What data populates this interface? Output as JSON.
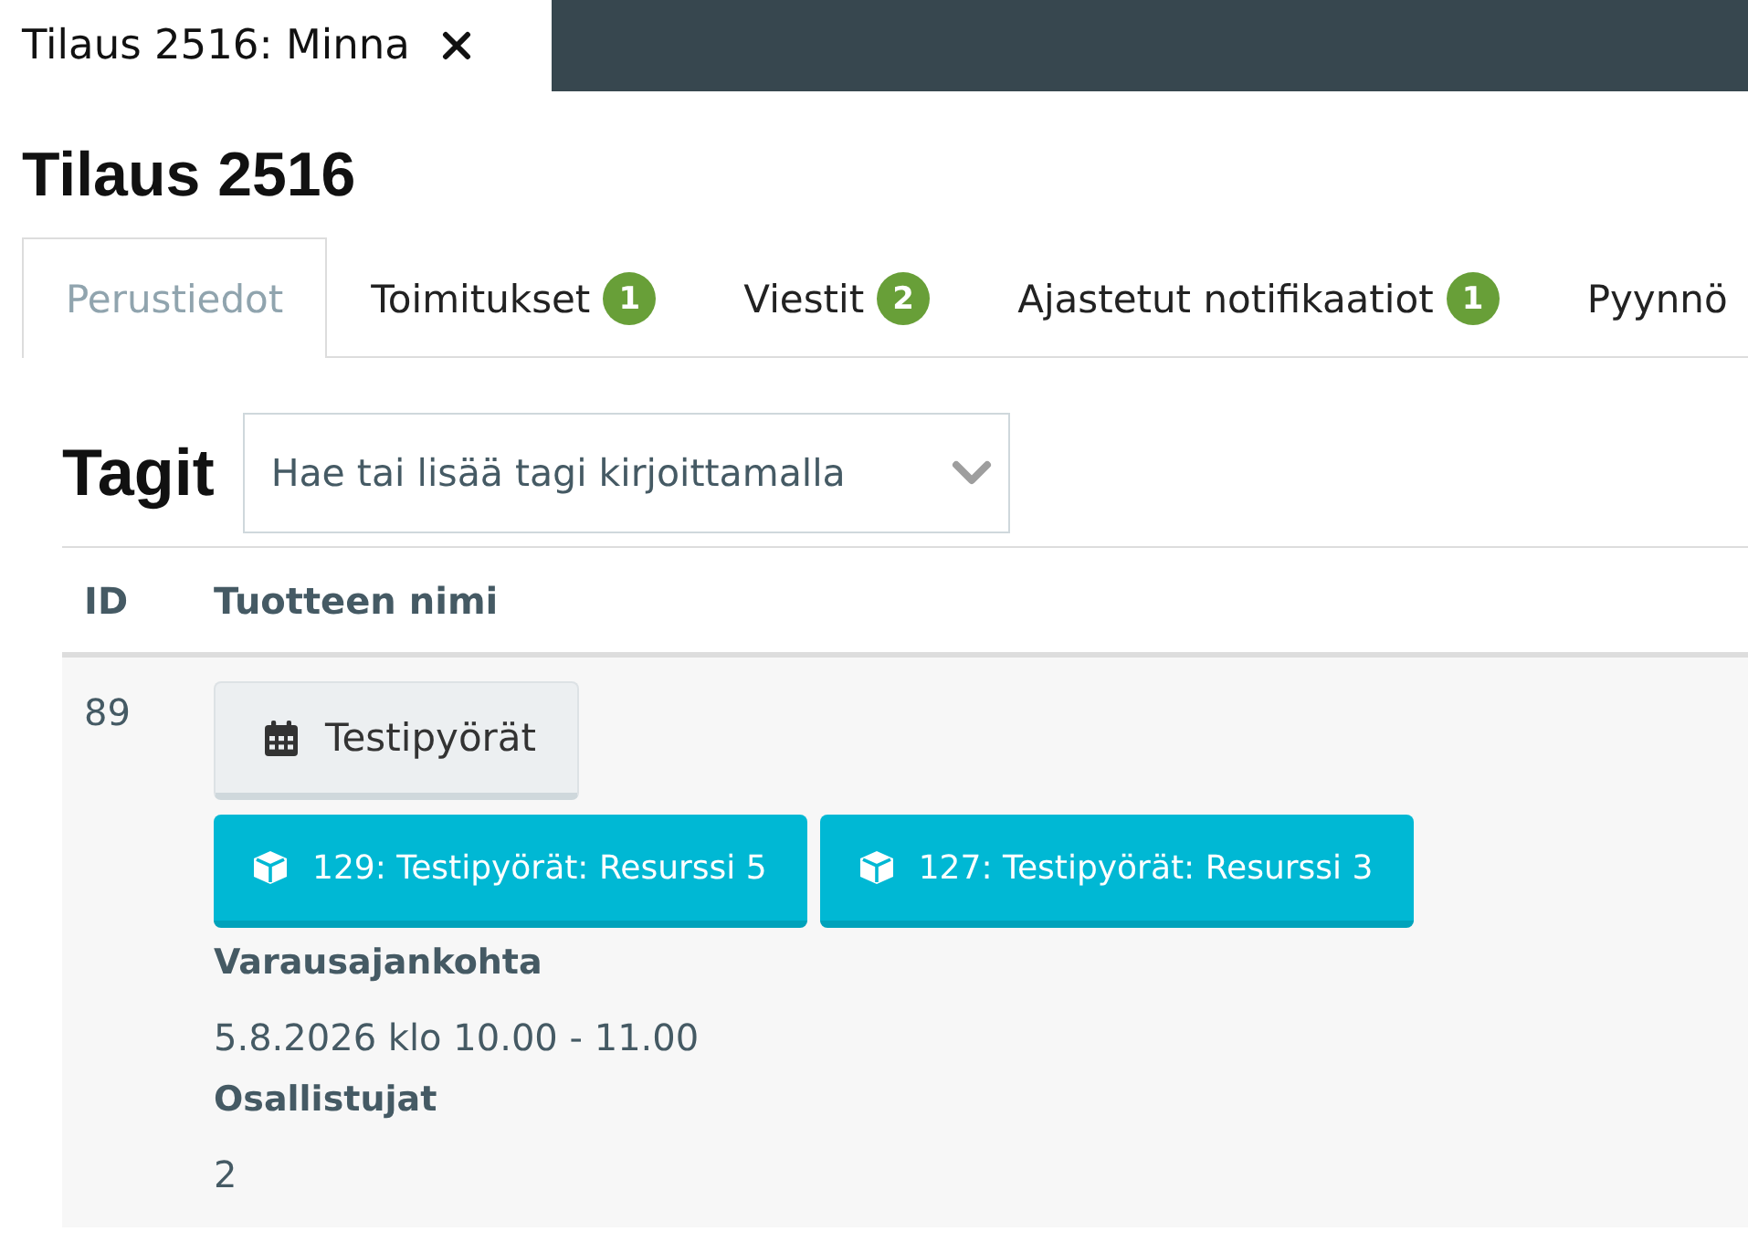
{
  "window_tabs": [
    {
      "title": "Tilaus 2516: Minna",
      "selected": true
    }
  ],
  "title": "Tilaus 2516",
  "tabs": [
    {
      "label": "Perustiedot",
      "selected": true
    },
    {
      "label": "Toimitukset",
      "badge": "1",
      "selected": false
    },
    {
      "label": "Viestit",
      "badge": "2",
      "selected": false
    },
    {
      "label": "Ajastetut notifikaatiot",
      "badge": "1",
      "selected": false
    },
    {
      "label": "Pyynnö",
      "selected": false
    }
  ],
  "tags": {
    "label": "Tagit",
    "placeholder": "Hae tai lisää tagi kirjoittamalla"
  },
  "table": {
    "columns": [
      "ID",
      "Tuotteen nimi"
    ],
    "rows": [
      {
        "id": "89",
        "product": "Testipyörät",
        "resources": [
          "129: Testipyörät: Resurssi 5",
          "127: Testipyörät: Resurssi 3"
        ],
        "details": [
          {
            "label": "Varausajankohta",
            "value": "5.8.2026 klo 10.00 - 11.00"
          },
          {
            "label": "Osallistujat",
            "value": "2"
          }
        ]
      }
    ]
  }
}
